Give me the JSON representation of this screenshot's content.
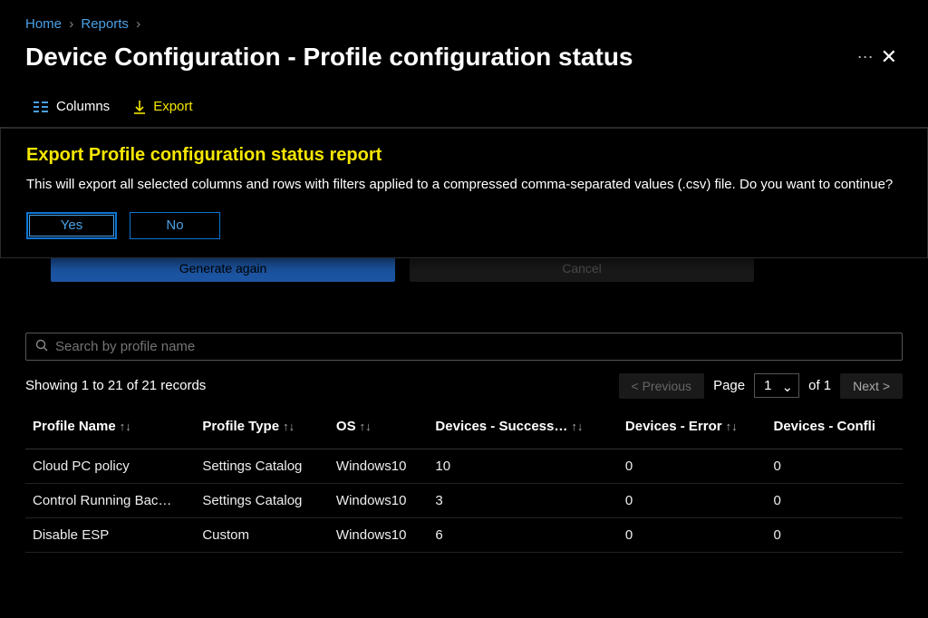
{
  "breadcrumb": {
    "home": "Home",
    "reports": "Reports"
  },
  "header": {
    "title": "Device Configuration - Profile configuration status"
  },
  "toolbar": {
    "columns_label": "Columns",
    "export_label": "Export"
  },
  "dialog": {
    "title": "Export Profile configuration status report",
    "body": "This will export all selected columns and rows with filters applied to a compressed comma-separated values (.csv) file. Do you want to continue?",
    "yes_label": "Yes",
    "no_label": "No"
  },
  "behind": {
    "generate_label": "Generate again",
    "cancel_label": "Cancel"
  },
  "search": {
    "placeholder": "Search by profile name"
  },
  "pager": {
    "showing": "Showing 1 to 21 of 21 records",
    "previous": "< Previous",
    "page_label": "Page",
    "current": "1",
    "of_label": "of 1",
    "next": "Next >"
  },
  "table": {
    "headers": {
      "profile_name": "Profile Name",
      "profile_type": "Profile Type",
      "os": "OS",
      "success": "Devices - Success…",
      "error": "Devices - Error",
      "conflict": "Devices - Confli"
    },
    "rows": [
      {
        "name": "Cloud PC policy",
        "type": "Settings Catalog",
        "os": "Windows10",
        "success": "10",
        "error": "0",
        "conflict": "0"
      },
      {
        "name": "Control Running Bac…",
        "type": "Settings Catalog",
        "os": "Windows10",
        "success": "3",
        "error": "0",
        "conflict": "0"
      },
      {
        "name": "Disable ESP",
        "type": "Custom",
        "os": "Windows10",
        "success": "6",
        "error": "0",
        "conflict": "0"
      }
    ]
  }
}
